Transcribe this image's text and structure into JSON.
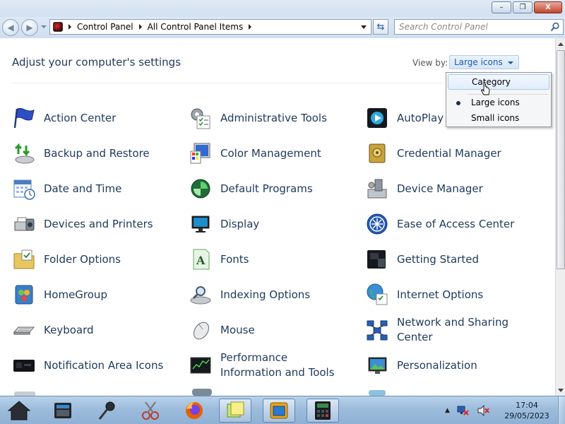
{
  "window": {
    "minimize": "–",
    "maximize": "❐",
    "close": "X"
  },
  "address": {
    "crumbs": [
      "Control Panel",
      "All Control Panel Items"
    ]
  },
  "search": {
    "placeholder": "Search Control Panel"
  },
  "header": {
    "title": "Adjust your computer's settings",
    "view_by_label": "View by:",
    "view_by_value": "Large icons"
  },
  "view_menu": {
    "items": [
      {
        "label": "Category",
        "state": "hovered"
      },
      {
        "label": "Large icons",
        "state": "selected"
      },
      {
        "label": "Small icons",
        "state": "normal"
      }
    ]
  },
  "items": [
    {
      "label": "Action Center",
      "icon": "flag-icon"
    },
    {
      "label": "Administrative Tools",
      "icon": "admin-tools-icon"
    },
    {
      "label": "AutoPlay",
      "icon": "autoplay-icon"
    },
    {
      "label": "Backup and Restore",
      "icon": "backup-icon"
    },
    {
      "label": "Color Management",
      "icon": "color-management-icon"
    },
    {
      "label": "Credential Manager",
      "icon": "vault-icon"
    },
    {
      "label": "Date and Time",
      "icon": "calendar-clock-icon"
    },
    {
      "label": "Default Programs",
      "icon": "default-programs-icon"
    },
    {
      "label": "Device Manager",
      "icon": "device-manager-icon"
    },
    {
      "label": "Devices and Printers",
      "icon": "printer-icon"
    },
    {
      "label": "Display",
      "icon": "monitor-icon"
    },
    {
      "label": "Ease of Access Center",
      "icon": "ease-of-access-icon"
    },
    {
      "label": "Folder Options",
      "icon": "folder-icon"
    },
    {
      "label": "Fonts",
      "icon": "fonts-icon"
    },
    {
      "label": "Getting Started",
      "icon": "getting-started-icon"
    },
    {
      "label": "HomeGroup",
      "icon": "homegroup-icon"
    },
    {
      "label": "Indexing Options",
      "icon": "indexing-icon"
    },
    {
      "label": "Internet Options",
      "icon": "globe-icon"
    },
    {
      "label": "Keyboard",
      "icon": "keyboard-icon"
    },
    {
      "label": "Mouse",
      "icon": "mouse-icon"
    },
    {
      "label": "Network and Sharing Center",
      "icon": "network-icon"
    },
    {
      "label": "Notification Area Icons",
      "icon": "notification-area-icon"
    },
    {
      "label": "Performance Information and Tools",
      "icon": "performance-icon"
    },
    {
      "label": "Personalization",
      "icon": "personalization-icon"
    }
  ],
  "taskbar": {
    "apps": [
      "home-icon",
      "file-manager-icon",
      "microphone-icon",
      "scissors-icon",
      "firefox-icon",
      "sticky-notes-icon",
      "window-app-icon",
      "calculator-app-icon"
    ],
    "clock_time": "17:04",
    "clock_date": "29/05/2023"
  },
  "colors": {
    "link_text": "#1e395b",
    "accent": "#1e5aa8",
    "taskbar": "#9dbcdc"
  }
}
